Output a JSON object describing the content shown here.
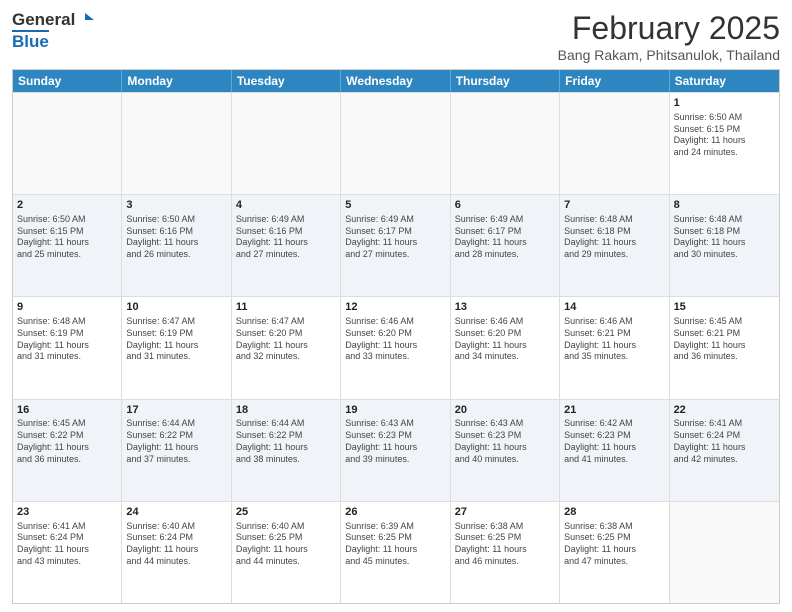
{
  "logo": {
    "general": "General",
    "blue": "Blue"
  },
  "header": {
    "month": "February 2025",
    "location": "Bang Rakam, Phitsanulok, Thailand"
  },
  "days": [
    "Sunday",
    "Monday",
    "Tuesday",
    "Wednesday",
    "Thursday",
    "Friday",
    "Saturday"
  ],
  "rows": [
    [
      {
        "day": "",
        "info": ""
      },
      {
        "day": "",
        "info": ""
      },
      {
        "day": "",
        "info": ""
      },
      {
        "day": "",
        "info": ""
      },
      {
        "day": "",
        "info": ""
      },
      {
        "day": "",
        "info": ""
      },
      {
        "day": "1",
        "info": "Sunrise: 6:50 AM\nSunset: 6:15 PM\nDaylight: 11 hours\nand 24 minutes."
      }
    ],
    [
      {
        "day": "2",
        "info": "Sunrise: 6:50 AM\nSunset: 6:15 PM\nDaylight: 11 hours\nand 25 minutes."
      },
      {
        "day": "3",
        "info": "Sunrise: 6:50 AM\nSunset: 6:16 PM\nDaylight: 11 hours\nand 26 minutes."
      },
      {
        "day": "4",
        "info": "Sunrise: 6:49 AM\nSunset: 6:16 PM\nDaylight: 11 hours\nand 27 minutes."
      },
      {
        "day": "5",
        "info": "Sunrise: 6:49 AM\nSunset: 6:17 PM\nDaylight: 11 hours\nand 27 minutes."
      },
      {
        "day": "6",
        "info": "Sunrise: 6:49 AM\nSunset: 6:17 PM\nDaylight: 11 hours\nand 28 minutes."
      },
      {
        "day": "7",
        "info": "Sunrise: 6:48 AM\nSunset: 6:18 PM\nDaylight: 11 hours\nand 29 minutes."
      },
      {
        "day": "8",
        "info": "Sunrise: 6:48 AM\nSunset: 6:18 PM\nDaylight: 11 hours\nand 30 minutes."
      }
    ],
    [
      {
        "day": "9",
        "info": "Sunrise: 6:48 AM\nSunset: 6:19 PM\nDaylight: 11 hours\nand 31 minutes."
      },
      {
        "day": "10",
        "info": "Sunrise: 6:47 AM\nSunset: 6:19 PM\nDaylight: 11 hours\nand 31 minutes."
      },
      {
        "day": "11",
        "info": "Sunrise: 6:47 AM\nSunset: 6:20 PM\nDaylight: 11 hours\nand 32 minutes."
      },
      {
        "day": "12",
        "info": "Sunrise: 6:46 AM\nSunset: 6:20 PM\nDaylight: 11 hours\nand 33 minutes."
      },
      {
        "day": "13",
        "info": "Sunrise: 6:46 AM\nSunset: 6:20 PM\nDaylight: 11 hours\nand 34 minutes."
      },
      {
        "day": "14",
        "info": "Sunrise: 6:46 AM\nSunset: 6:21 PM\nDaylight: 11 hours\nand 35 minutes."
      },
      {
        "day": "15",
        "info": "Sunrise: 6:45 AM\nSunset: 6:21 PM\nDaylight: 11 hours\nand 36 minutes."
      }
    ],
    [
      {
        "day": "16",
        "info": "Sunrise: 6:45 AM\nSunset: 6:22 PM\nDaylight: 11 hours\nand 36 minutes."
      },
      {
        "day": "17",
        "info": "Sunrise: 6:44 AM\nSunset: 6:22 PM\nDaylight: 11 hours\nand 37 minutes."
      },
      {
        "day": "18",
        "info": "Sunrise: 6:44 AM\nSunset: 6:22 PM\nDaylight: 11 hours\nand 38 minutes."
      },
      {
        "day": "19",
        "info": "Sunrise: 6:43 AM\nSunset: 6:23 PM\nDaylight: 11 hours\nand 39 minutes."
      },
      {
        "day": "20",
        "info": "Sunrise: 6:43 AM\nSunset: 6:23 PM\nDaylight: 11 hours\nand 40 minutes."
      },
      {
        "day": "21",
        "info": "Sunrise: 6:42 AM\nSunset: 6:23 PM\nDaylight: 11 hours\nand 41 minutes."
      },
      {
        "day": "22",
        "info": "Sunrise: 6:41 AM\nSunset: 6:24 PM\nDaylight: 11 hours\nand 42 minutes."
      }
    ],
    [
      {
        "day": "23",
        "info": "Sunrise: 6:41 AM\nSunset: 6:24 PM\nDaylight: 11 hours\nand 43 minutes."
      },
      {
        "day": "24",
        "info": "Sunrise: 6:40 AM\nSunset: 6:24 PM\nDaylight: 11 hours\nand 44 minutes."
      },
      {
        "day": "25",
        "info": "Sunrise: 6:40 AM\nSunset: 6:25 PM\nDaylight: 11 hours\nand 44 minutes."
      },
      {
        "day": "26",
        "info": "Sunrise: 6:39 AM\nSunset: 6:25 PM\nDaylight: 11 hours\nand 45 minutes."
      },
      {
        "day": "27",
        "info": "Sunrise: 6:38 AM\nSunset: 6:25 PM\nDaylight: 11 hours\nand 46 minutes."
      },
      {
        "day": "28",
        "info": "Sunrise: 6:38 AM\nSunset: 6:25 PM\nDaylight: 11 hours\nand 47 minutes."
      },
      {
        "day": "",
        "info": ""
      }
    ]
  ]
}
